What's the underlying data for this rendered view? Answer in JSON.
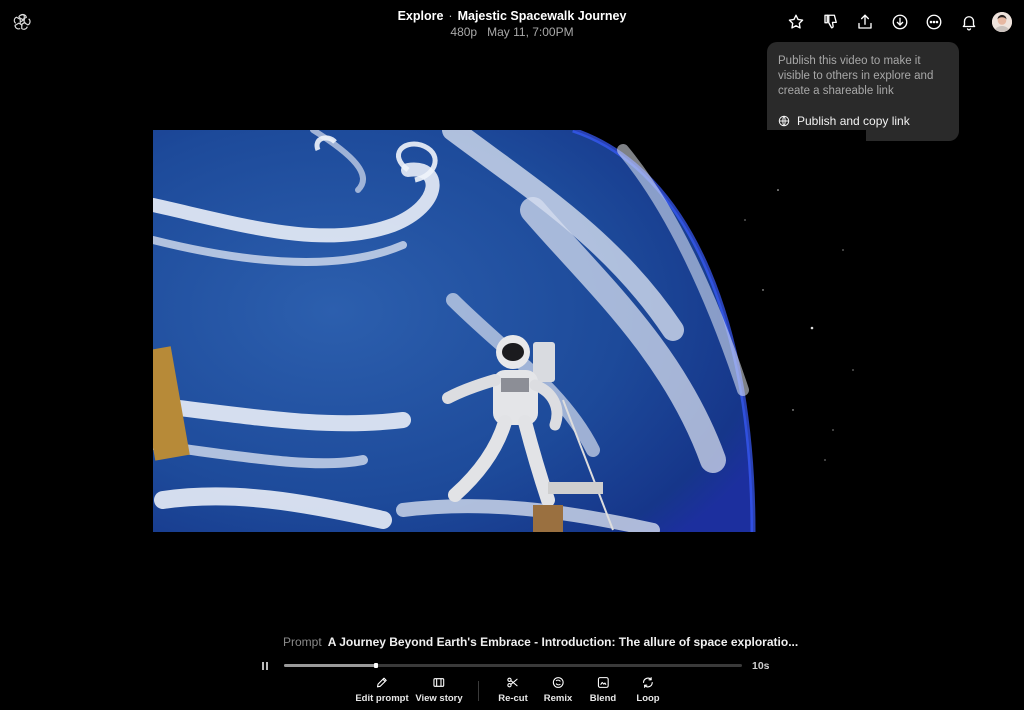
{
  "header": {
    "breadcrumb": "Explore",
    "separator": "·",
    "title": "Majestic Spacewalk Journey",
    "resolution": "480p",
    "timestamp": "May 11, 7:00PM"
  },
  "toolbar_icons": [
    "star-icon",
    "thumbs-down-icon",
    "share-upload-icon",
    "download-icon",
    "more-options-icon",
    "bell-icon",
    "avatar"
  ],
  "publish_popover": {
    "description": "Publish this video to make it visible to others in explore and create a shareable link",
    "action_label": "Publish and copy link",
    "action_icon": "globe-icon"
  },
  "player": {
    "prompt_label": "Prompt",
    "prompt_text": "A Journey Beyond Earth's Embrace - Introduction: The allure of space exploratio...",
    "duration": "10s",
    "progress": 0.2
  },
  "actions": [
    {
      "label": "Edit prompt",
      "icon": "pencil-icon"
    },
    {
      "label": "View story",
      "icon": "storyboard-icon"
    },
    {
      "label": "Re-cut",
      "icon": "scissors-icon"
    },
    {
      "label": "Remix",
      "icon": "remix-icon"
    },
    {
      "label": "Blend",
      "icon": "blend-icon"
    },
    {
      "label": "Loop",
      "icon": "loop-icon"
    }
  ],
  "colors": {
    "background": "#000000",
    "popover": "#2a2a2a",
    "muted_text": "#a9a9a9"
  }
}
